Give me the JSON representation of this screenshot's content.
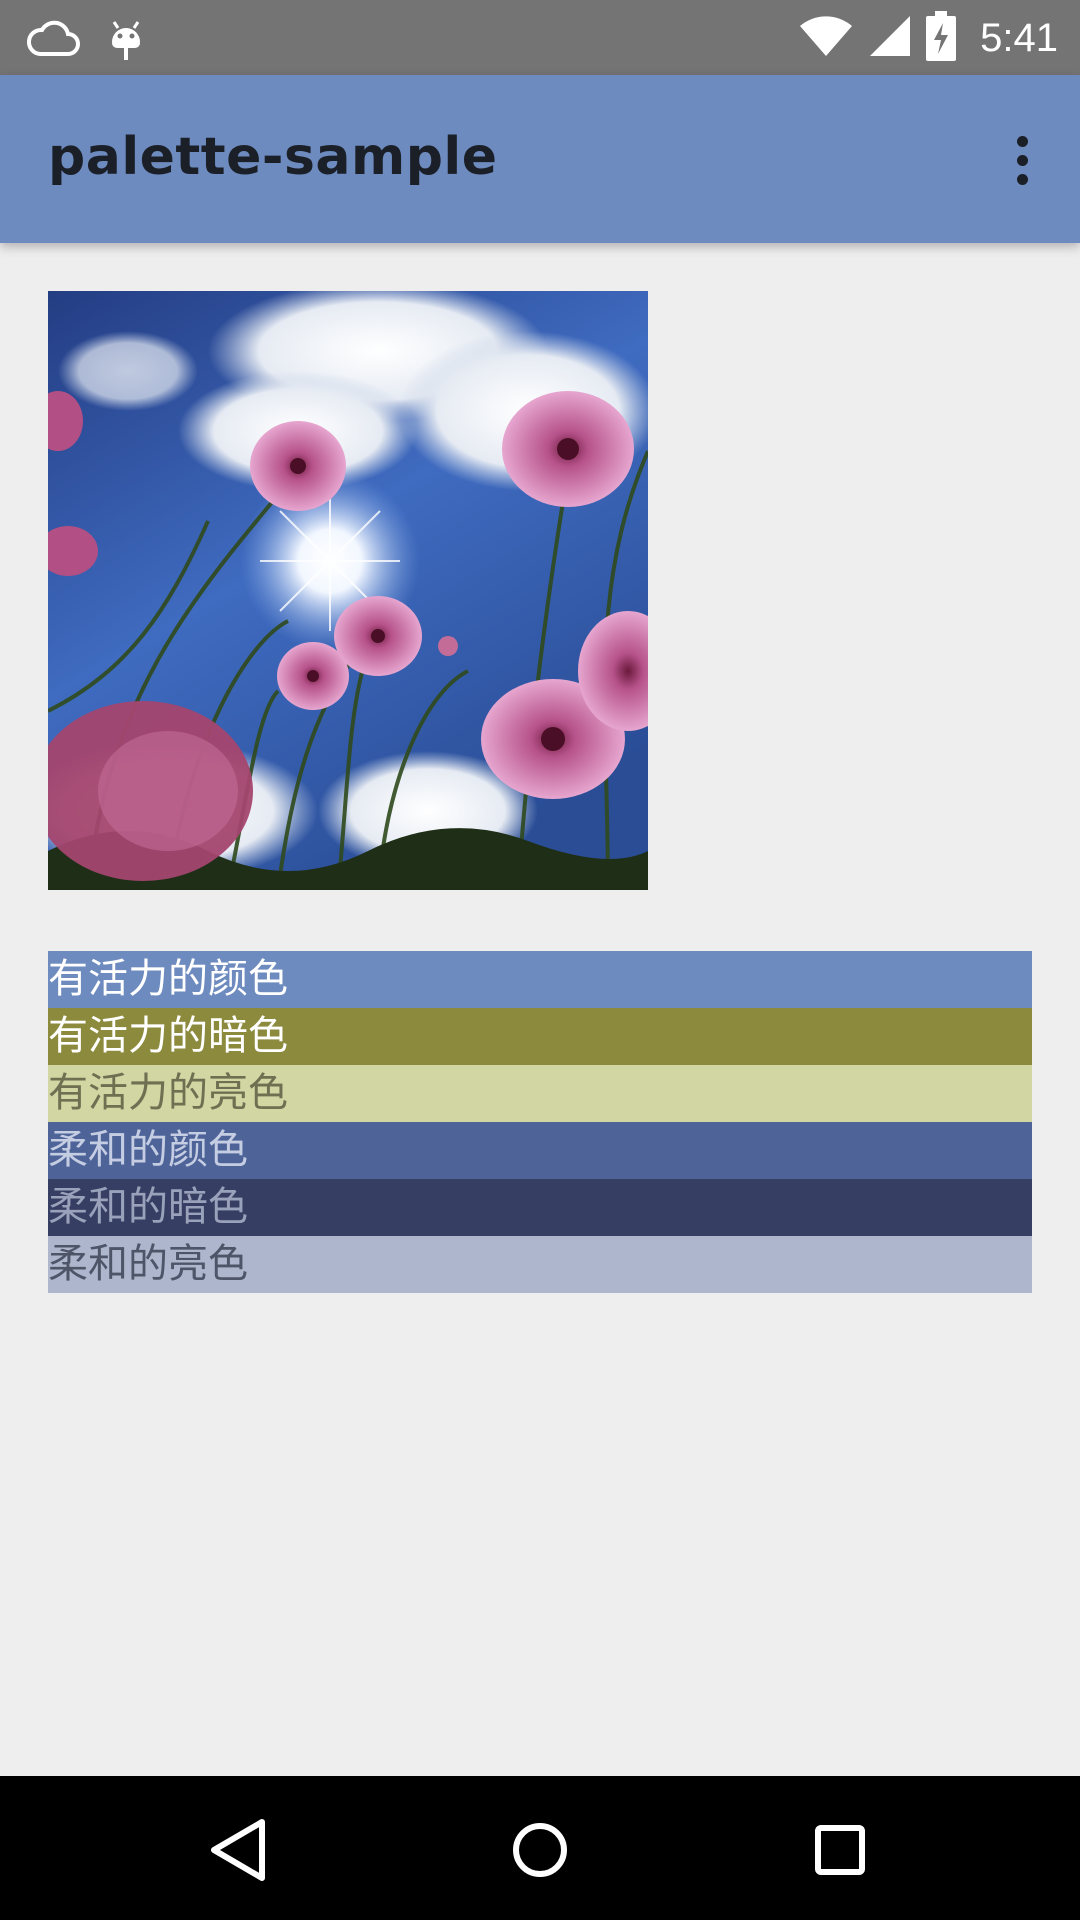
{
  "status_bar": {
    "time": "5:41",
    "icons": [
      "cloud-icon",
      "android-debug-icon",
      "wifi-icon",
      "signal-icon",
      "battery-charging-icon"
    ]
  },
  "app_bar": {
    "title": "palette-sample",
    "overflow_icon": "more-vertical-icon"
  },
  "image": {
    "description": "pink-cosmos-flowers-against-sky"
  },
  "swatches": [
    {
      "label": "有活力的颜色",
      "bg": "#6d8bbf",
      "text_color": "#ffffff"
    },
    {
      "label": "有活力的暗色",
      "bg": "#8c8a3c",
      "text_color": "#ffffff"
    },
    {
      "label": "有活力的亮色",
      "bg": "#d2d6a2",
      "text_color": "#6f6f52"
    },
    {
      "label": "柔和的颜色",
      "bg": "#4e6499",
      "text_color": "#c5cde3"
    },
    {
      "label": "柔和的暗色",
      "bg": "#363f63",
      "text_color": "#9aa1ba"
    },
    {
      "label": "柔和的亮色",
      "bg": "#adb6cd",
      "text_color": "#4f5568"
    }
  ],
  "nav_bar": {
    "buttons": [
      "back-icon",
      "home-icon",
      "recents-icon"
    ]
  },
  "colors": {
    "primary": "#6d8bbf",
    "status_bar": "#747474",
    "background": "#eeeeee"
  }
}
